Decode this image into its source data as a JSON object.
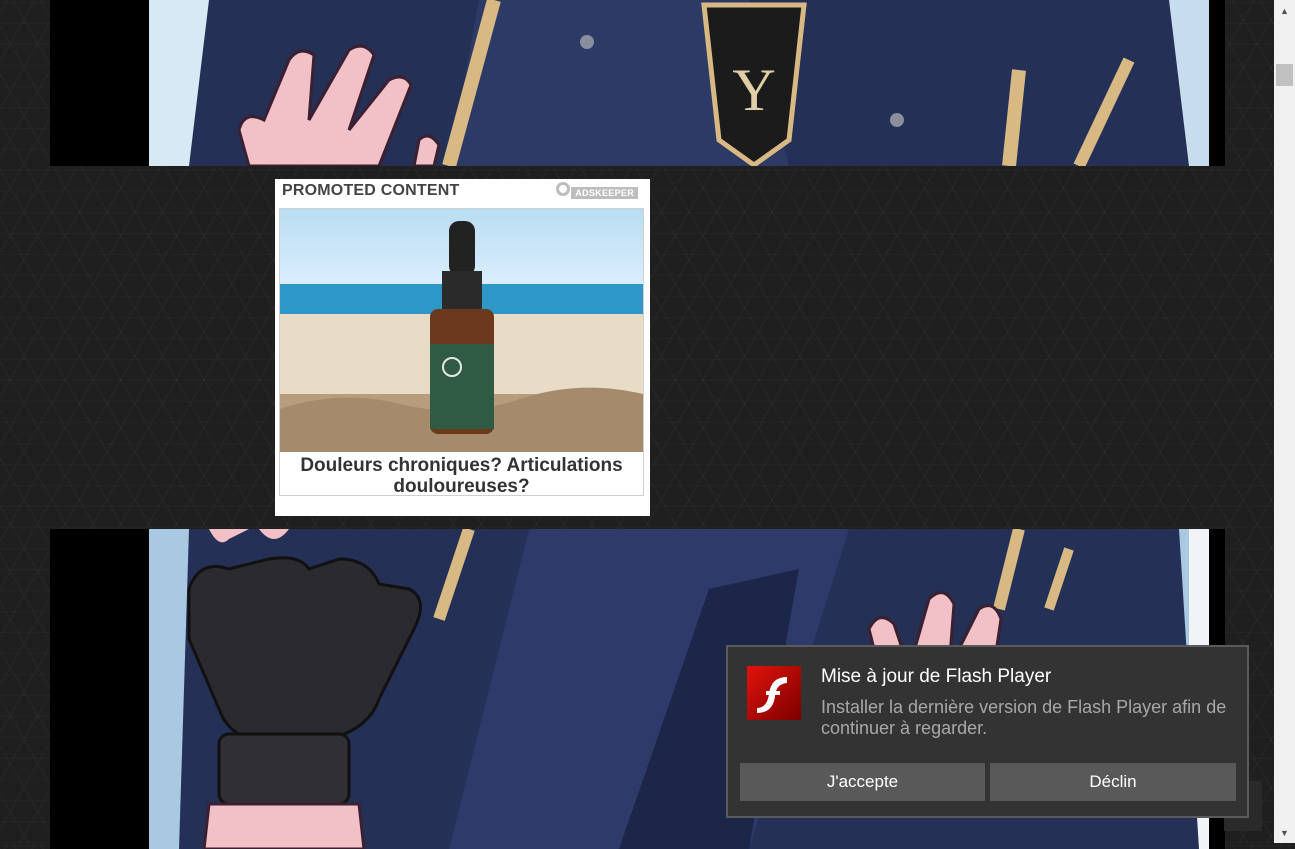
{
  "ad": {
    "header": "PROMOTED CONTENT",
    "brand": "ADSKEEPER",
    "title": "Douleurs chroniques? Articulations douloureuses?"
  },
  "popup": {
    "icon": "flash-player-icon",
    "title": "Mise à jour de Flash Player",
    "message": "Installer la dernière version de Flash Player afin de continuer à regarder.",
    "accept_label": "J'accepte",
    "decline_label": "Déclin"
  },
  "scrollbar": {
    "up_arrow": "▲",
    "down_arrow": "▼"
  },
  "colors": {
    "page_bg": "#1f1f1f",
    "popup_bg": "#333333",
    "button_bg": "#595959",
    "flash_red": "#cc0000"
  }
}
